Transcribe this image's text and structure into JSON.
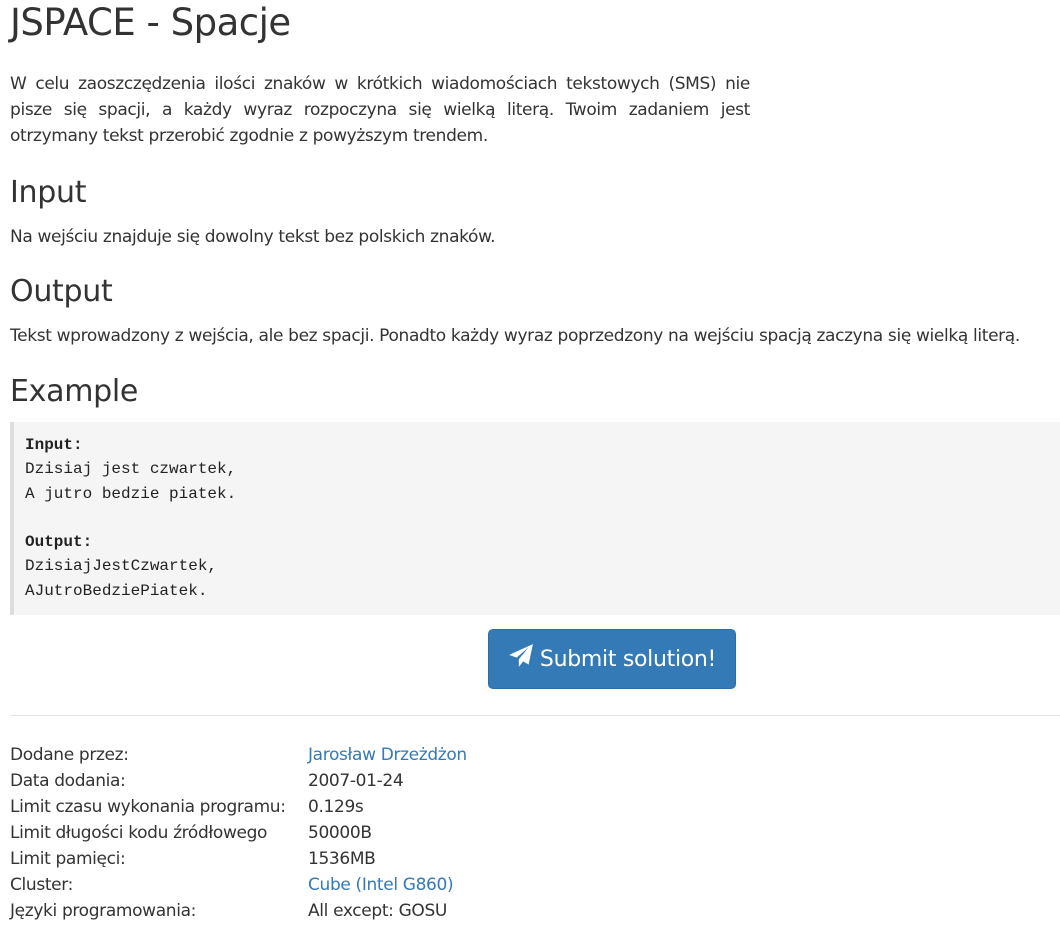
{
  "problem": {
    "title": "JSPACE - Spacje",
    "description": "W celu zaoszczędzenia ilości znaków w krótkich wiadomościach tekstowych (SMS) nie pisze się spacji, a każdy wyraz rozpoczyna się wielką literą. Twoim zadaniem jest otrzymany tekst przerobić zgodnie z powyższym trendem."
  },
  "input_section": {
    "heading": "Input",
    "text": "Na wejściu znajduje się dowolny tekst bez polskich znaków."
  },
  "output_section": {
    "heading": "Output",
    "text": "Tekst wprowadzony z wejścia, ale bez spacji. Ponadto każdy wyraz poprzedzony na wejściu spacją zaczyna się wielką literą."
  },
  "example": {
    "heading": "Example",
    "input_label": "Input:",
    "input_lines": "Dzisiaj jest czwartek,\nA jutro bedzie piatek.",
    "output_label": "Output:",
    "output_lines": "DzisiajJestCzwartek,\nAJutroBedziePiatek."
  },
  "submit": {
    "label": "Submit solution!",
    "icon": "paper-plane-icon",
    "color": "#337ab7"
  },
  "info": {
    "rows": [
      {
        "label": "Dodane przez:",
        "value": "Jarosław Drzeżdżon",
        "link": true
      },
      {
        "label": "Data dodania:",
        "value": "2007-01-24",
        "link": false
      },
      {
        "label": "Limit czasu wykonania programu:",
        "value": "0.129s",
        "link": false
      },
      {
        "label": "Limit długości kodu źródłowego",
        "value": "50000B",
        "link": false
      },
      {
        "label": "Limit pamięci:",
        "value": "1536MB",
        "link": false
      },
      {
        "label": "Cluster:",
        "value": "Cube (Intel G860)",
        "link": true
      },
      {
        "label": "Języki programowania:",
        "value": "All except: GOSU",
        "link": false
      }
    ]
  }
}
